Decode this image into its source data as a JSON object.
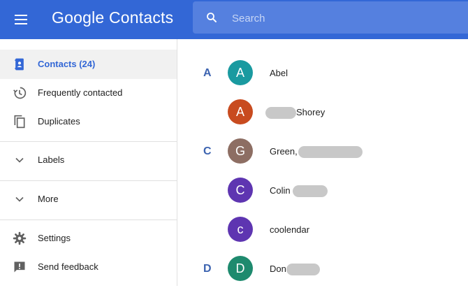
{
  "header": {
    "logo": "Google Contacts",
    "search_placeholder": "Search"
  },
  "sidebar": {
    "items": [
      {
        "label": "Contacts (24)",
        "icon": "contacts-book-icon",
        "active": true
      },
      {
        "label": "Frequently contacted",
        "icon": "history-icon"
      },
      {
        "label": "Duplicates",
        "icon": "duplicates-icon"
      },
      {
        "label": "Labels",
        "icon": "chevron-down-icon"
      },
      {
        "label": "More",
        "icon": "chevron-down-icon"
      },
      {
        "label": "Settings",
        "icon": "gear-icon"
      },
      {
        "label": "Send feedback",
        "icon": "feedback-icon"
      }
    ]
  },
  "contacts": [
    {
      "letter": "A",
      "initial": "A",
      "name": "Abel",
      "color": "#1a9aa0"
    },
    {
      "letter": "",
      "initial": "A",
      "name": "Shorey",
      "color": "#c84b1f"
    },
    {
      "letter": "C",
      "initial": "G",
      "name": "Green,",
      "color": "#8d6e63"
    },
    {
      "letter": "",
      "initial": "C",
      "name": "Colin",
      "color": "#5e35b1"
    },
    {
      "letter": "",
      "initial": "c",
      "name": "coolendar",
      "color": "#5e35b1"
    },
    {
      "letter": "D",
      "initial": "D",
      "name": "Don",
      "color": "#1e8a6e"
    }
  ],
  "colors": {
    "header_bg": "#3367d6",
    "accent": "#3367d6"
  }
}
